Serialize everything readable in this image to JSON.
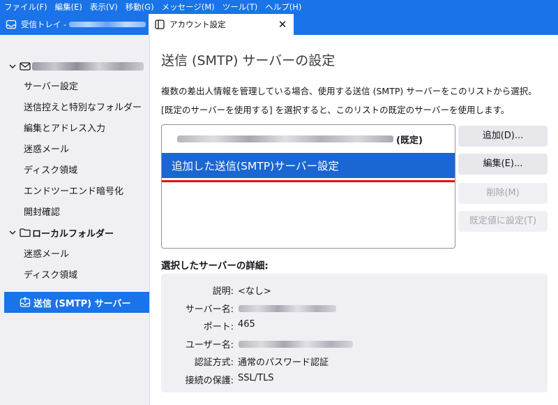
{
  "menu": [
    "ファイル(F)",
    "編集(E)",
    "表示(V)",
    "移動(G)",
    "メッセージ(M)",
    "ツール(T)",
    "ヘルプ(H)"
  ],
  "tabs": {
    "inbox_label": "受信トレイ -",
    "active_label": "アカウント設定",
    "close_glyph": "✕"
  },
  "sidebar": {
    "account_icon": "mail-envelope-icon",
    "items_account": [
      "サーバー設定",
      "送信控えと特別なフォルダー",
      "編集とアドレス入力",
      "迷惑メール",
      "ディスク領域",
      "エンドツーエンド暗号化",
      "開封確認"
    ],
    "local_folders": "ローカルフォルダー",
    "items_local": [
      "迷惑メール",
      "ディスク領域"
    ],
    "smtp_label": "送信 (SMTP) サーバー"
  },
  "main": {
    "title": "送信 (SMTP) サーバーの設定",
    "desc1": "複数の差出人情報を管理している場合、使用する送信 (SMTP) サーバーをこのリストから選択。",
    "desc2": "[既定のサーバーを使用する] を選択すると、このリストの既定のサーバーを使用します。",
    "list": {
      "default_suffix": "(既定)",
      "selected_item": "追加した送信(SMTP)サーバー設定"
    },
    "buttons": {
      "add": "追加(D)...",
      "edit": "編集(E)...",
      "delete": "削除(M)",
      "set_default": "既定値に設定(T)"
    },
    "details_title": "選択したサーバーの詳細:",
    "details": {
      "description_label": "説明:",
      "description_value": "<なし>",
      "server_label": "サーバー名:",
      "port_label": "ポート:",
      "port_value": "465",
      "user_label": "ユーザー名:",
      "auth_label": "認証方式:",
      "auth_value": "通常のパスワード認証",
      "security_label": "接続の保護:",
      "security_value": "SSL/TLS"
    }
  },
  "colors": {
    "accent": "#1a73e8",
    "selected_row": "#1a66d2",
    "highlight_line": "#e3140e",
    "sidebar_bg": "#f0f0f4"
  }
}
